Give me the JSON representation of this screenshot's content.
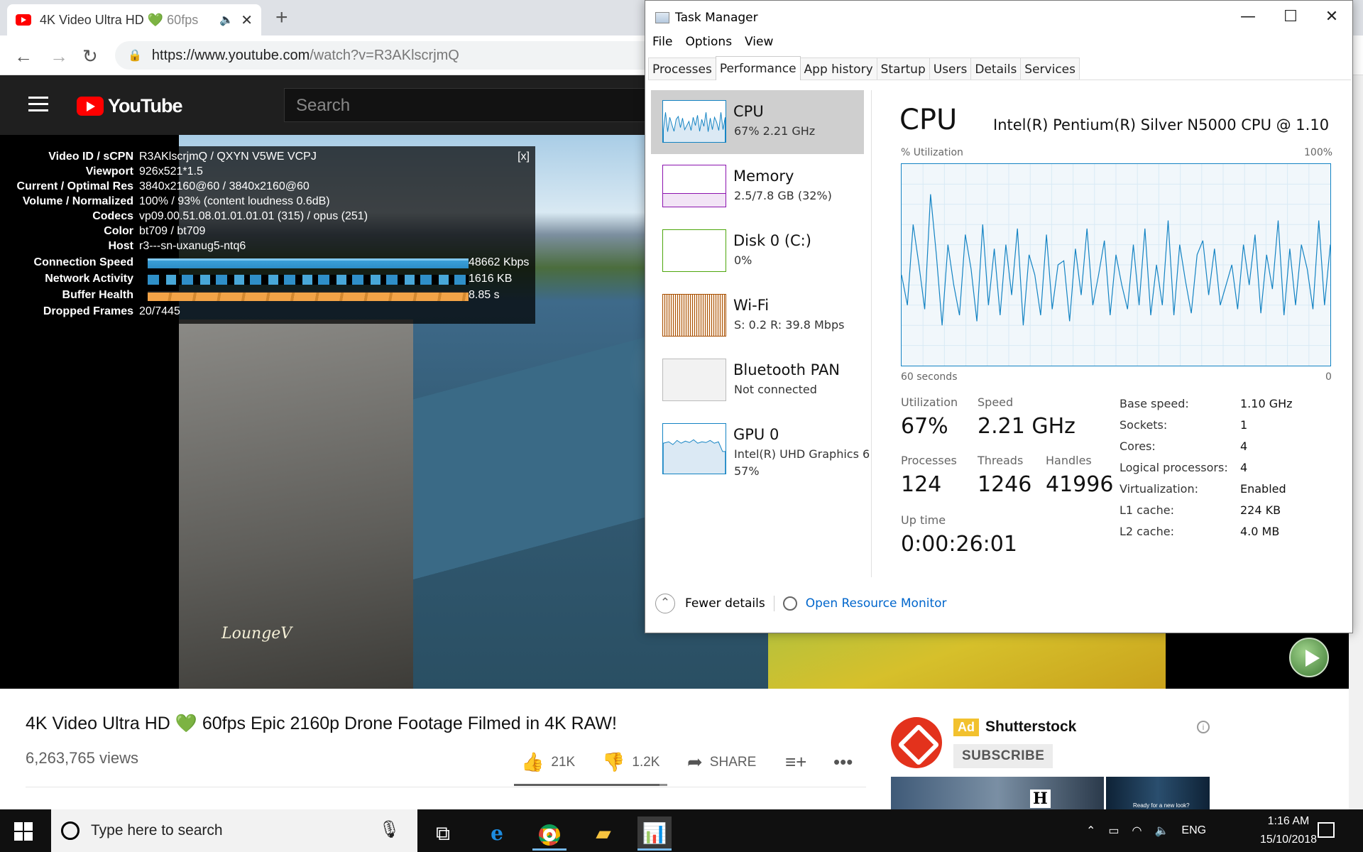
{
  "browser": {
    "tab_title": "4K Video Ultra HD",
    "tab_heart": "💚",
    "tab_title_rest": " 60fps",
    "url_host": "https://www.youtube.com",
    "url_path": "/watch?v=R3AKlscrjmQ",
    "new_tab": "+"
  },
  "youtube": {
    "logo": "YouTube",
    "search_placeholder": "Search",
    "watermark": "LoungeV",
    "video_title": "4K Video Ultra HD",
    "video_title_heart": "💚",
    "video_title_rest": " 60fps Epic 2160p Drone Footage Filmed in 4K RAW!",
    "views": "6,263,765 views",
    "likes": "21K",
    "dislikes": "1.2K",
    "share": "SHARE",
    "like_ratio": 0.95,
    "ad": {
      "badge": "Ad",
      "name": "Shutterstock",
      "subscribe": "SUBSCRIBE",
      "thumb1_letter": "H",
      "thumb2_caption": "Ready for a new look?"
    }
  },
  "stats": {
    "close": "[x]",
    "rows": [
      {
        "label": "Video ID / sCPN",
        "value": "R3AKlscrjmQ / QXYN V5WE VCPJ"
      },
      {
        "label": "Viewport",
        "value": "926x521*1.5"
      },
      {
        "label": "Current / Optimal Res",
        "value": "3840x2160@60 / 3840x2160@60"
      },
      {
        "label": "Volume / Normalized",
        "value": "100% / 93% (content loudness 0.6dB)"
      },
      {
        "label": "Codecs",
        "value": "vp09.00.51.08.01.01.01.01 (315) / opus (251)"
      },
      {
        "label": "Color",
        "value": "bt709 / bt709"
      },
      {
        "label": "Host",
        "value": "r3---sn-uxanug5-ntq6"
      },
      {
        "label": "Connection Speed",
        "value": "48662 Kbps"
      },
      {
        "label": "Network Activity",
        "value": "1616 KB"
      },
      {
        "label": "Buffer Health",
        "value": "8.85 s"
      },
      {
        "label": "Dropped Frames",
        "value": "20/7445"
      }
    ]
  },
  "taskmanager": {
    "title": "Task Manager",
    "menu": [
      "File",
      "Options",
      "View"
    ],
    "tabs": [
      "Processes",
      "Performance",
      "App history",
      "Startup",
      "Users",
      "Details",
      "Services"
    ],
    "active_tab": "Performance",
    "sidebar": [
      {
        "name": "CPU",
        "sub": "67%  2.21 GHz",
        "color": "#1383c3"
      },
      {
        "name": "Memory",
        "sub": "2.5/7.8 GB (32%)",
        "color": "#8b12ae"
      },
      {
        "name": "Disk 0 (C:)",
        "sub": "0%",
        "color": "#4da60c"
      },
      {
        "name": "Wi-Fi",
        "sub": "S:  0.2  R:  39.8 Mbps",
        "color": "#a74f01"
      },
      {
        "name": "Bluetooth PAN",
        "sub": "Not connected",
        "color": "#aaaaaa"
      },
      {
        "name": "GPU 0",
        "sub": "Intel(R) UHD Graphics 6",
        "sub2": "57%",
        "color": "#1383c3"
      }
    ],
    "cpu": {
      "heading": "CPU",
      "model": "Intel(R) Pentium(R) Silver N5000 CPU @ 1.10",
      "util_label": "% Utilization",
      "util_max": "100%",
      "time_label": "60 seconds",
      "time_end": "0",
      "graph_values": [
        45,
        30,
        70,
        50,
        28,
        85,
        55,
        20,
        60,
        40,
        25,
        65,
        48,
        22,
        70,
        30,
        58,
        25,
        60,
        35,
        68,
        20,
        55,
        45,
        25,
        65,
        28,
        50,
        52,
        22,
        58,
        35,
        68,
        30,
        45,
        62,
        25,
        55,
        40,
        28,
        60,
        30,
        68,
        25,
        50,
        30,
        72,
        25,
        60,
        42,
        26,
        55,
        62,
        35,
        58,
        30,
        40,
        50,
        28,
        60,
        40,
        65,
        26,
        55,
        38,
        72,
        25,
        58,
        30,
        60,
        48,
        28,
        72,
        30,
        60
      ],
      "utilization_label": "Utilization",
      "utilization": "67%",
      "speed_label": "Speed",
      "speed": "2.21 GHz",
      "processes_label": "Processes",
      "processes": "124",
      "threads_label": "Threads",
      "threads": "1246",
      "handles_label": "Handles",
      "handles": "41996",
      "uptime_label": "Up time",
      "uptime": "0:00:26:01",
      "specs": [
        {
          "k": "Base speed:",
          "v": "1.10 GHz"
        },
        {
          "k": "Sockets:",
          "v": "1"
        },
        {
          "k": "Cores:",
          "v": "4"
        },
        {
          "k": "Logical processors:",
          "v": "4"
        },
        {
          "k": "Virtualization:",
          "v": "Enabled"
        },
        {
          "k": "L1 cache:",
          "v": "224 KB"
        },
        {
          "k": "L2 cache:",
          "v": "4.0 MB"
        }
      ]
    },
    "fewer_details": "Fewer details",
    "resource_monitor": "Open Resource Monitor"
  },
  "taskbar": {
    "search_placeholder": "Type here to search",
    "lang": "ENG",
    "time": "1:16 AM",
    "date": "15/10/2018"
  }
}
